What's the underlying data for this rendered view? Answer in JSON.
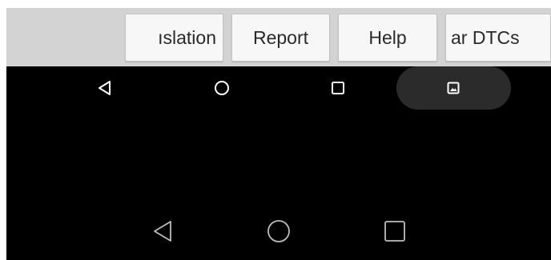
{
  "toolbar": {
    "buttons": [
      {
        "label": "ıslation"
      },
      {
        "label": "Report"
      },
      {
        "label": "Help"
      },
      {
        "label": "ar DTCs"
      }
    ]
  },
  "nav_top": {
    "icons": [
      "back-triangle-icon",
      "home-circle-icon",
      "recents-square-icon",
      "screenshot-icon"
    ],
    "pill_color": "#2b2b2b"
  },
  "nav_bottom": {
    "icons": [
      "back-triangle-icon",
      "home-circle-icon",
      "recents-square-icon"
    ]
  }
}
